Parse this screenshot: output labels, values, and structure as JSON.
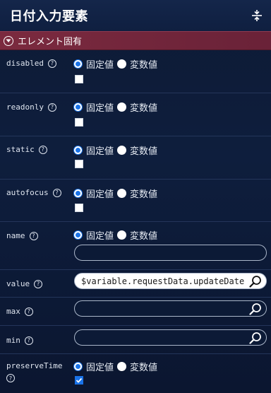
{
  "header": {
    "title": "日付入力要素"
  },
  "section": {
    "label": "エレメント固有"
  },
  "radio_options": {
    "fixed": "固定値",
    "variable": "変数値"
  },
  "properties": {
    "disabled": {
      "label": "disabled",
      "checked": false
    },
    "readonly": {
      "label": "readonly",
      "checked": false
    },
    "static": {
      "label": "static",
      "checked": false
    },
    "autofocus": {
      "label": "autofocus",
      "checked": false
    },
    "name": {
      "label": "name",
      "value": ""
    },
    "value": {
      "label": "value",
      "value": "$variable.requestData.updateDate"
    },
    "max": {
      "label": "max",
      "value": ""
    },
    "min": {
      "label": "min",
      "value": ""
    },
    "preserveTime": {
      "label": "preserveTime",
      "checked": true
    }
  },
  "help_glyph": "?",
  "colors": {
    "accent": "#1a73e8",
    "section_bar": "#7b2a3f",
    "background": "#0d1a35"
  }
}
